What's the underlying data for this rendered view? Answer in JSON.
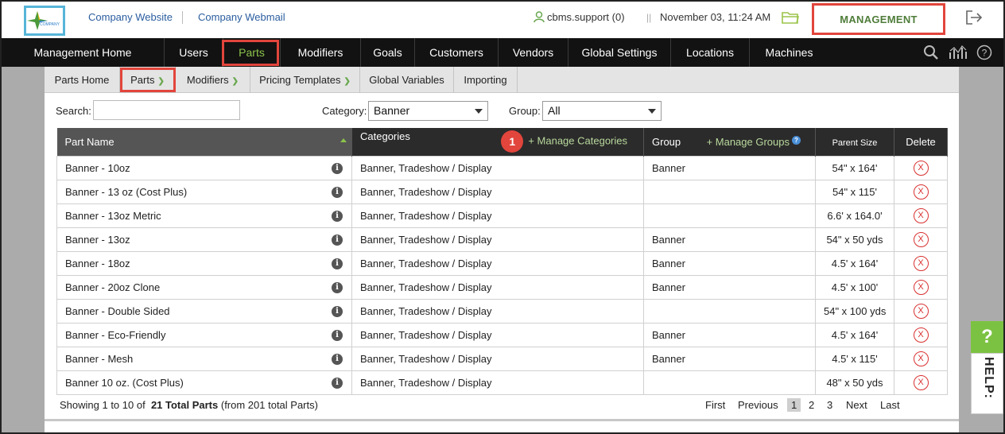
{
  "header": {
    "links": [
      "Company Website",
      "Company Webmail"
    ],
    "user": "cbms.support (0)",
    "datetime": "November 03, 11:24 AM",
    "management": "MANAGEMENT"
  },
  "main_nav": [
    "Management Home",
    "Users",
    "Parts",
    "Modifiers",
    "Goals",
    "Customers",
    "Vendors",
    "Global Settings",
    "Locations",
    "Machines"
  ],
  "sub_nav": {
    "parts_home": "Parts Home",
    "parts": "Parts",
    "modifiers": "Modifiers",
    "pricing_templates": "Pricing Templates",
    "global_variables": "Global Variables",
    "importing": "Importing"
  },
  "filters": {
    "search_label": "Search:",
    "search_value": "",
    "category_label": "Category:",
    "category_value": "Banner",
    "group_label": "Group:",
    "group_value": "All"
  },
  "table": {
    "headers": {
      "part_name": "Part Name",
      "categories": "Categories",
      "manage_categories": "+ Manage Categories",
      "badge": "1",
      "group": "Group",
      "manage_groups": "+ Manage Groups",
      "parent_size": "Parent Size",
      "delete": "Delete"
    },
    "rows": [
      {
        "name": "Banner - 10oz",
        "categories": "Banner, Tradeshow / Display",
        "group": "Banner",
        "size": "54\" x 164'"
      },
      {
        "name": "Banner - 13 oz (Cost Plus)",
        "categories": "Banner, Tradeshow / Display",
        "group": "",
        "size": "54\" x 115'"
      },
      {
        "name": "Banner - 13oz Metric",
        "categories": "Banner, Tradeshow / Display",
        "group": "",
        "size": "6.6' x 164.0'"
      },
      {
        "name": "Banner - 13oz",
        "categories": "Banner, Tradeshow / Display",
        "group": "Banner",
        "size": "54\" x 50 yds"
      },
      {
        "name": "Banner - 18oz",
        "categories": "Banner, Tradeshow / Display",
        "group": "Banner",
        "size": "4.5' x 164'"
      },
      {
        "name": "Banner - 20oz Clone",
        "categories": "Banner, Tradeshow / Display",
        "group": "Banner",
        "size": "4.5' x 100'"
      },
      {
        "name": "Banner - Double Sided",
        "categories": "Banner, Tradeshow / Display",
        "group": "",
        "size": "54\" x 100 yds"
      },
      {
        "name": "Banner - Eco-Friendly",
        "categories": "Banner, Tradeshow / Display",
        "group": "Banner",
        "size": "4.5' x 164'"
      },
      {
        "name": "Banner - Mesh",
        "categories": "Banner, Tradeshow / Display",
        "group": "Banner",
        "size": "4.5' x 115'"
      },
      {
        "name": "Banner 10 oz. (Cost Plus)",
        "categories": "Banner, Tradeshow / Display",
        "group": "",
        "size": "48\" x 50 yds"
      }
    ],
    "delete_symbol": "X"
  },
  "footer": {
    "showing": "Showing 1 to 10 of",
    "total": "21 Total Parts",
    "from": "(from 201 total Parts)",
    "pager": {
      "first": "First",
      "previous": "Previous",
      "pages": [
        "1",
        "2",
        "3"
      ],
      "next": "Next",
      "last": "Last"
    }
  },
  "help": {
    "q": "?",
    "label": "HELP:"
  },
  "colors": {
    "accent_green": "#8bc34a",
    "highlight_red": "#e2453c",
    "nav_bg": "#121212",
    "link_blue": "#2a5d9f"
  },
  "icons": [
    "company-logo",
    "user-icon",
    "folder-icon",
    "logout-icon",
    "search-icon",
    "analytics-icon",
    "help-circle-icon",
    "info-icon",
    "delete-icon",
    "sort-asc-icon"
  ]
}
